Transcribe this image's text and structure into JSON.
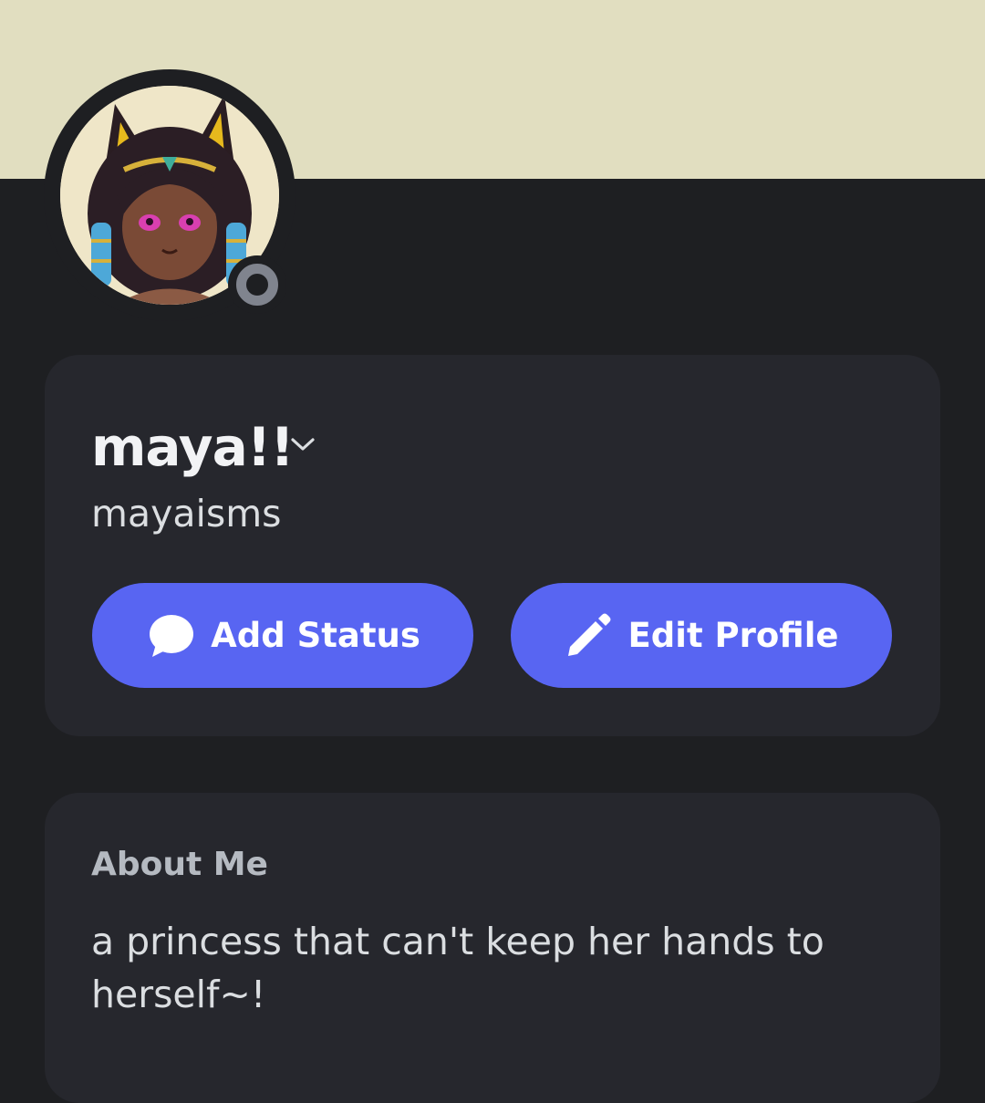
{
  "profile": {
    "display_name": "maya!!",
    "username": "mayaisms",
    "presence": "offline",
    "banner_color": "#e1dec0"
  },
  "actions": {
    "add_status_label": "Add Status",
    "edit_profile_label": "Edit Profile",
    "accent_color": "#5865f2"
  },
  "about": {
    "heading": "About Me",
    "text": "a princess that can't keep her hands to herself~!"
  },
  "icons": {
    "display_name_chevron": "chevron-down-icon",
    "add_status": "speech-bubble-icon",
    "edit_profile": "pencil-icon",
    "presence": "offline-status-icon"
  }
}
